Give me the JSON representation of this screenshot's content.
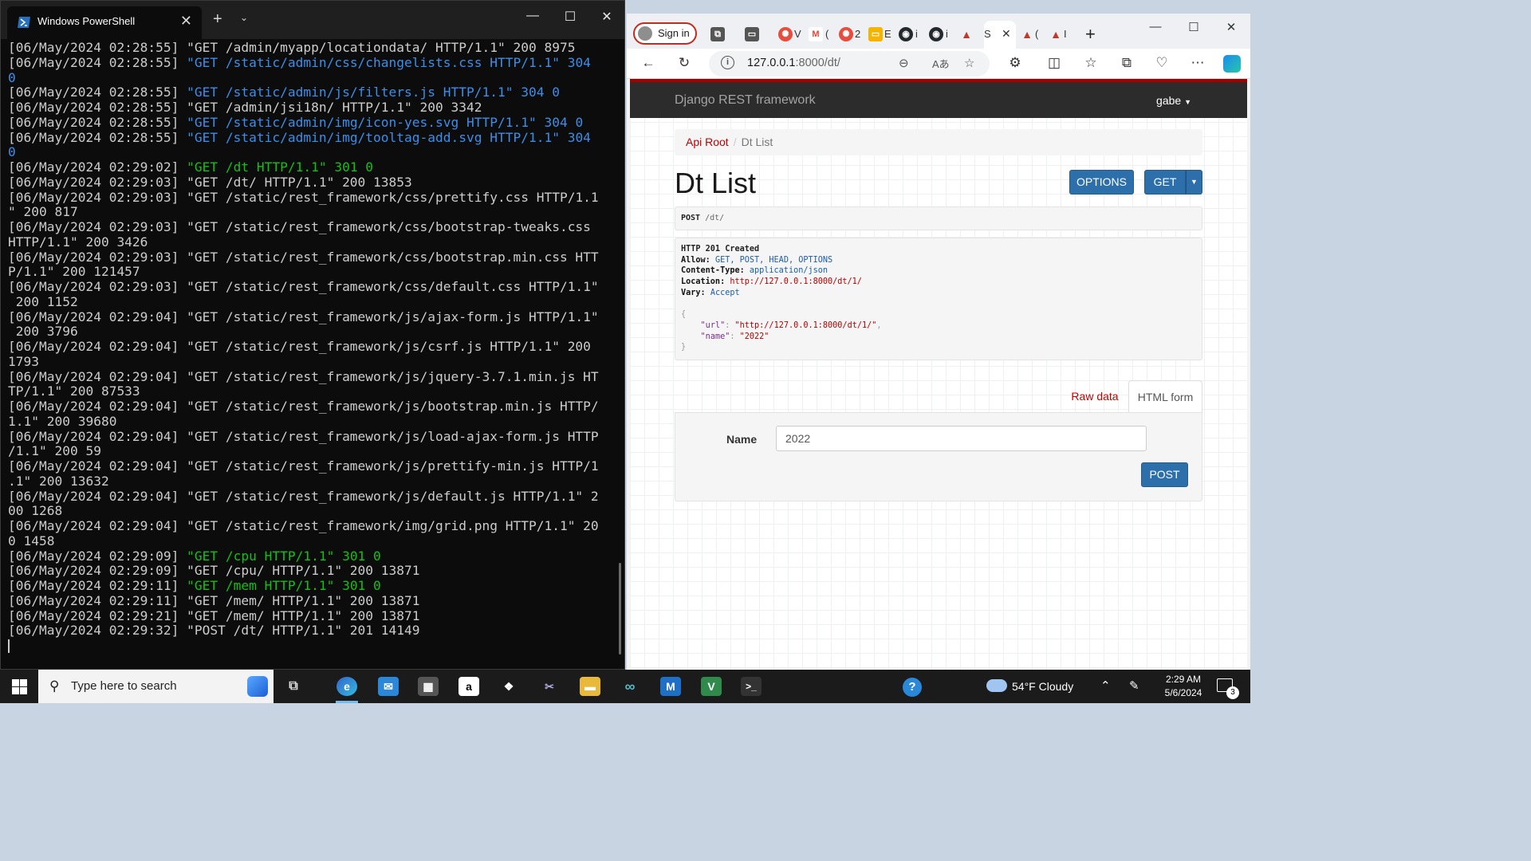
{
  "powershell": {
    "title": "Windows PowerShell",
    "lines": [
      {
        "text": "[06/May/2024 02:28:55] \"GET /admin/myapp/locationdata/ HTTP/1.1\" 200 8975",
        "color": "default"
      },
      {
        "text": "[06/May/2024 02:28:55] \"GET /static/admin/css/changelists.css HTTP/1.1\" 304",
        "color": "blue"
      },
      {
        "text": "0",
        "color": "blue"
      },
      {
        "text": "[06/May/2024 02:28:55] \"GET /static/admin/js/filters.js HTTP/1.1\" 304 0",
        "color": "blue"
      },
      {
        "text": "[06/May/2024 02:28:55] \"GET /admin/jsi18n/ HTTP/1.1\" 200 3342",
        "color": "default"
      },
      {
        "text": "[06/May/2024 02:28:55] \"GET /static/admin/img/icon-yes.svg HTTP/1.1\" 304 0",
        "color": "blue"
      },
      {
        "text": "[06/May/2024 02:28:55] \"GET /static/admin/img/tooltag-add.svg HTTP/1.1\" 304",
        "color": "blue"
      },
      {
        "text": "0",
        "color": "blue"
      },
      {
        "text": "[06/May/2024 02:29:02] \"GET /dt HTTP/1.1\" 301 0",
        "color": "green"
      },
      {
        "text": "[06/May/2024 02:29:03] \"GET /dt/ HTTP/1.1\" 200 13853",
        "color": "default"
      },
      {
        "text": "[06/May/2024 02:29:03] \"GET /static/rest_framework/css/prettify.css HTTP/1.1",
        "color": "default"
      },
      {
        "text": "\" 200 817",
        "color": "default"
      },
      {
        "text": "[06/May/2024 02:29:03] \"GET /static/rest_framework/css/bootstrap-tweaks.css",
        "color": "default"
      },
      {
        "text": "HTTP/1.1\" 200 3426",
        "color": "default"
      },
      {
        "text": "[06/May/2024 02:29:03] \"GET /static/rest_framework/css/bootstrap.min.css HTT",
        "color": "default"
      },
      {
        "text": "P/1.1\" 200 121457",
        "color": "default"
      },
      {
        "text": "[06/May/2024 02:29:03] \"GET /static/rest_framework/css/default.css HTTP/1.1\"",
        "color": "default"
      },
      {
        "text": " 200 1152",
        "color": "default"
      },
      {
        "text": "[06/May/2024 02:29:04] \"GET /static/rest_framework/js/ajax-form.js HTTP/1.1\"",
        "color": "default"
      },
      {
        "text": " 200 3796",
        "color": "default"
      },
      {
        "text": "[06/May/2024 02:29:04] \"GET /static/rest_framework/js/csrf.js HTTP/1.1\" 200",
        "color": "default"
      },
      {
        "text": "1793",
        "color": "default"
      },
      {
        "text": "[06/May/2024 02:29:04] \"GET /static/rest_framework/js/jquery-3.7.1.min.js HT",
        "color": "default"
      },
      {
        "text": "TP/1.1\" 200 87533",
        "color": "default"
      },
      {
        "text": "[06/May/2024 02:29:04] \"GET /static/rest_framework/js/bootstrap.min.js HTTP/",
        "color": "default"
      },
      {
        "text": "1.1\" 200 39680",
        "color": "default"
      },
      {
        "text": "[06/May/2024 02:29:04] \"GET /static/rest_framework/js/load-ajax-form.js HTTP",
        "color": "default"
      },
      {
        "text": "/1.1\" 200 59",
        "color": "default"
      },
      {
        "text": "[06/May/2024 02:29:04] \"GET /static/rest_framework/js/prettify-min.js HTTP/1",
        "color": "default"
      },
      {
        "text": ".1\" 200 13632",
        "color": "default"
      },
      {
        "text": "[06/May/2024 02:29:04] \"GET /static/rest_framework/js/default.js HTTP/1.1\" 2",
        "color": "default"
      },
      {
        "text": "00 1268",
        "color": "default"
      },
      {
        "text": "[06/May/2024 02:29:04] \"GET /static/rest_framework/img/grid.png HTTP/1.1\" 20",
        "color": "default"
      },
      {
        "text": "0 1458",
        "color": "default"
      },
      {
        "text": "[06/May/2024 02:29:09] \"GET /cpu HTTP/1.1\" 301 0",
        "color": "green"
      },
      {
        "text": "[06/May/2024 02:29:09] \"GET /cpu/ HTTP/1.1\" 200 13871",
        "color": "default"
      },
      {
        "text": "[06/May/2024 02:29:11] \"GET /mem HTTP/1.1\" 301 0",
        "color": "green"
      },
      {
        "text": "[06/May/2024 02:29:11] \"GET /mem/ HTTP/1.1\" 200 13871",
        "color": "default"
      },
      {
        "text": "[06/May/2024 02:29:21] \"GET /mem/ HTTP/1.1\" 200 13871",
        "color": "default"
      },
      {
        "text": "[06/May/2024 02:29:32] \"POST /dt/ HTTP/1.1\" 201 14149",
        "color": "default"
      }
    ]
  },
  "browser": {
    "sign_in_label": "Sign in",
    "tabs": [
      {
        "icon": "collections-icon",
        "label": ""
      },
      {
        "icon": "tab-actions-icon",
        "label": ""
      },
      {
        "icon": "app-red-icon",
        "label": "V",
        "color": "#e74c3c"
      },
      {
        "icon": "gmail-icon",
        "label": "(",
        "color": "#ea4335"
      },
      {
        "icon": "app-red-icon",
        "label": "2",
        "color": "#e74c3c"
      },
      {
        "icon": "slides-icon",
        "label": "E",
        "color": "#f4b400"
      },
      {
        "icon": "github-icon",
        "label": "i",
        "color": "#24292e"
      },
      {
        "icon": "github-icon",
        "label": "i",
        "color": "#24292e"
      },
      {
        "icon": "django-logo-icon",
        "label": "",
        "color": "#c0392b"
      },
      {
        "icon": "active-tab",
        "label": "S"
      },
      {
        "icon": "django-logo-icon",
        "label": "(",
        "color": "#c0392b"
      },
      {
        "icon": "django-logo-icon",
        "label": "I",
        "color": "#c0392b"
      }
    ],
    "address": {
      "host": "127.0.0.1",
      "path": ":8000/dt/"
    },
    "page": {
      "brand": "Django REST framework",
      "user": "gabe",
      "breadcrumb": {
        "root": "Api Root",
        "current": "Dt List"
      },
      "title": "Dt List",
      "options_button": "OPTIONS",
      "get_button": "GET",
      "request": {
        "method": "POST",
        "path": "/dt/"
      },
      "response": {
        "status": "HTTP 201 Created",
        "headers": [
          {
            "key": "Allow:",
            "value": "GET, POST, HEAD, OPTIONS"
          },
          {
            "key": "Content-Type:",
            "value": "application/json"
          },
          {
            "key": "Location:",
            "value": "http://127.0.0.1:8000/dt/1/"
          },
          {
            "key": "Vary:",
            "value": "Accept"
          }
        ],
        "body": {
          "url_key": "\"url\"",
          "url_val": "\"http://127.0.0.1:8000/dt/1/\"",
          "name_key": "\"name\"",
          "name_val": "\"2022\""
        }
      },
      "tabs": {
        "raw": "Raw data",
        "html": "HTML form"
      },
      "form": {
        "name_label": "Name",
        "name_value": "2022",
        "post_button": "POST"
      }
    }
  },
  "taskbar": {
    "search_placeholder": "Type here to search",
    "weather": "54°F  Cloudy",
    "time": "2:29 AM",
    "date": "5/6/2024",
    "notification_count": "3"
  }
}
